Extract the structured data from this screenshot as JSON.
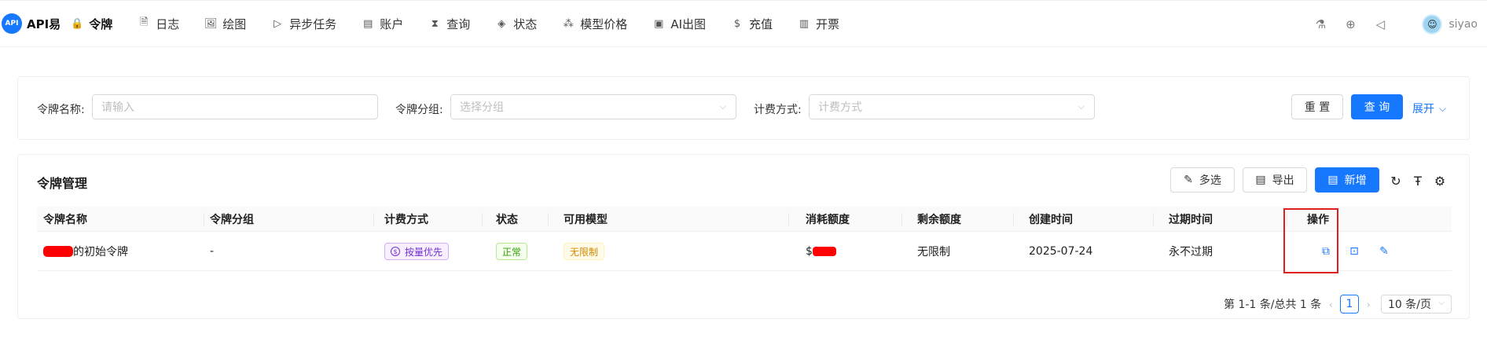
{
  "brand": {
    "logo_text": "API",
    "name": "API易"
  },
  "nav": {
    "items": [
      {
        "label": "令牌",
        "icon": "🔒",
        "active": true
      },
      {
        "label": "日志",
        "icon": "🗎"
      },
      {
        "label": "绘图",
        "icon": "🖼"
      },
      {
        "label": "异步任务",
        "icon": "▷"
      },
      {
        "label": "账户",
        "icon": "▤"
      },
      {
        "label": "查询",
        "icon": "⧗"
      },
      {
        "label": "状态",
        "icon": "◈"
      },
      {
        "label": "模型价格",
        "icon": "⁂"
      },
      {
        "label": "AI出图",
        "icon": "▣"
      },
      {
        "label": "充值",
        "icon": "$"
      },
      {
        "label": "开票",
        "icon": "▥"
      }
    ],
    "right_icons": {
      "flask": "⚗",
      "globe": "⊕",
      "megaphone": "◁"
    },
    "avatar_glyph": "☺",
    "username": "siyao"
  },
  "filters": {
    "token_name_label": "令牌名称:",
    "token_name_placeholder": "请输入",
    "token_group_label": "令牌分组:",
    "token_group_placeholder": "选择分组",
    "billing_label": "计费方式:",
    "billing_placeholder": "计费方式",
    "chevron": "⌵",
    "reset_label": "重 置",
    "query_label": "查 询",
    "expand_label": "展开",
    "expand_chevron": "⌵"
  },
  "table_card": {
    "title": "令牌管理",
    "multiselect_label": "多选",
    "multiselect_icon": "✎",
    "export_label": "导出",
    "export_icon": "▤",
    "add_label": "新增",
    "add_icon": "▤",
    "refresh_icon": "↻",
    "density_icon": "Ŧ",
    "settings_icon": "⚙",
    "columns": [
      "令牌名称",
      "令牌分组",
      "计费方式",
      "状态",
      "可用模型",
      "消耗额度",
      "剩余额度",
      "创建时间",
      "过期时间",
      "操作"
    ],
    "rows": [
      {
        "name_suffix": "的初始令牌",
        "group": "-",
        "billing": "按量优先",
        "billing_icon": "$",
        "status": "正常",
        "models": "无限制",
        "used_prefix": "$",
        "remaining": "无限制",
        "created": "2025-07-24",
        "expires": "永不过期"
      }
    ],
    "action_icons": {
      "copy": "⧉",
      "view": "⊡",
      "edit": "✎"
    }
  },
  "pagination": {
    "summary": "第 1-1 条/总共 1 条",
    "prev": "‹",
    "current_page": "1",
    "next": "›",
    "page_size": "10 条/页",
    "chevron": "⌵"
  },
  "colors": {
    "primary": "#1677ff",
    "highlight_box": "#e02020",
    "redaction": "#ff0000"
  }
}
